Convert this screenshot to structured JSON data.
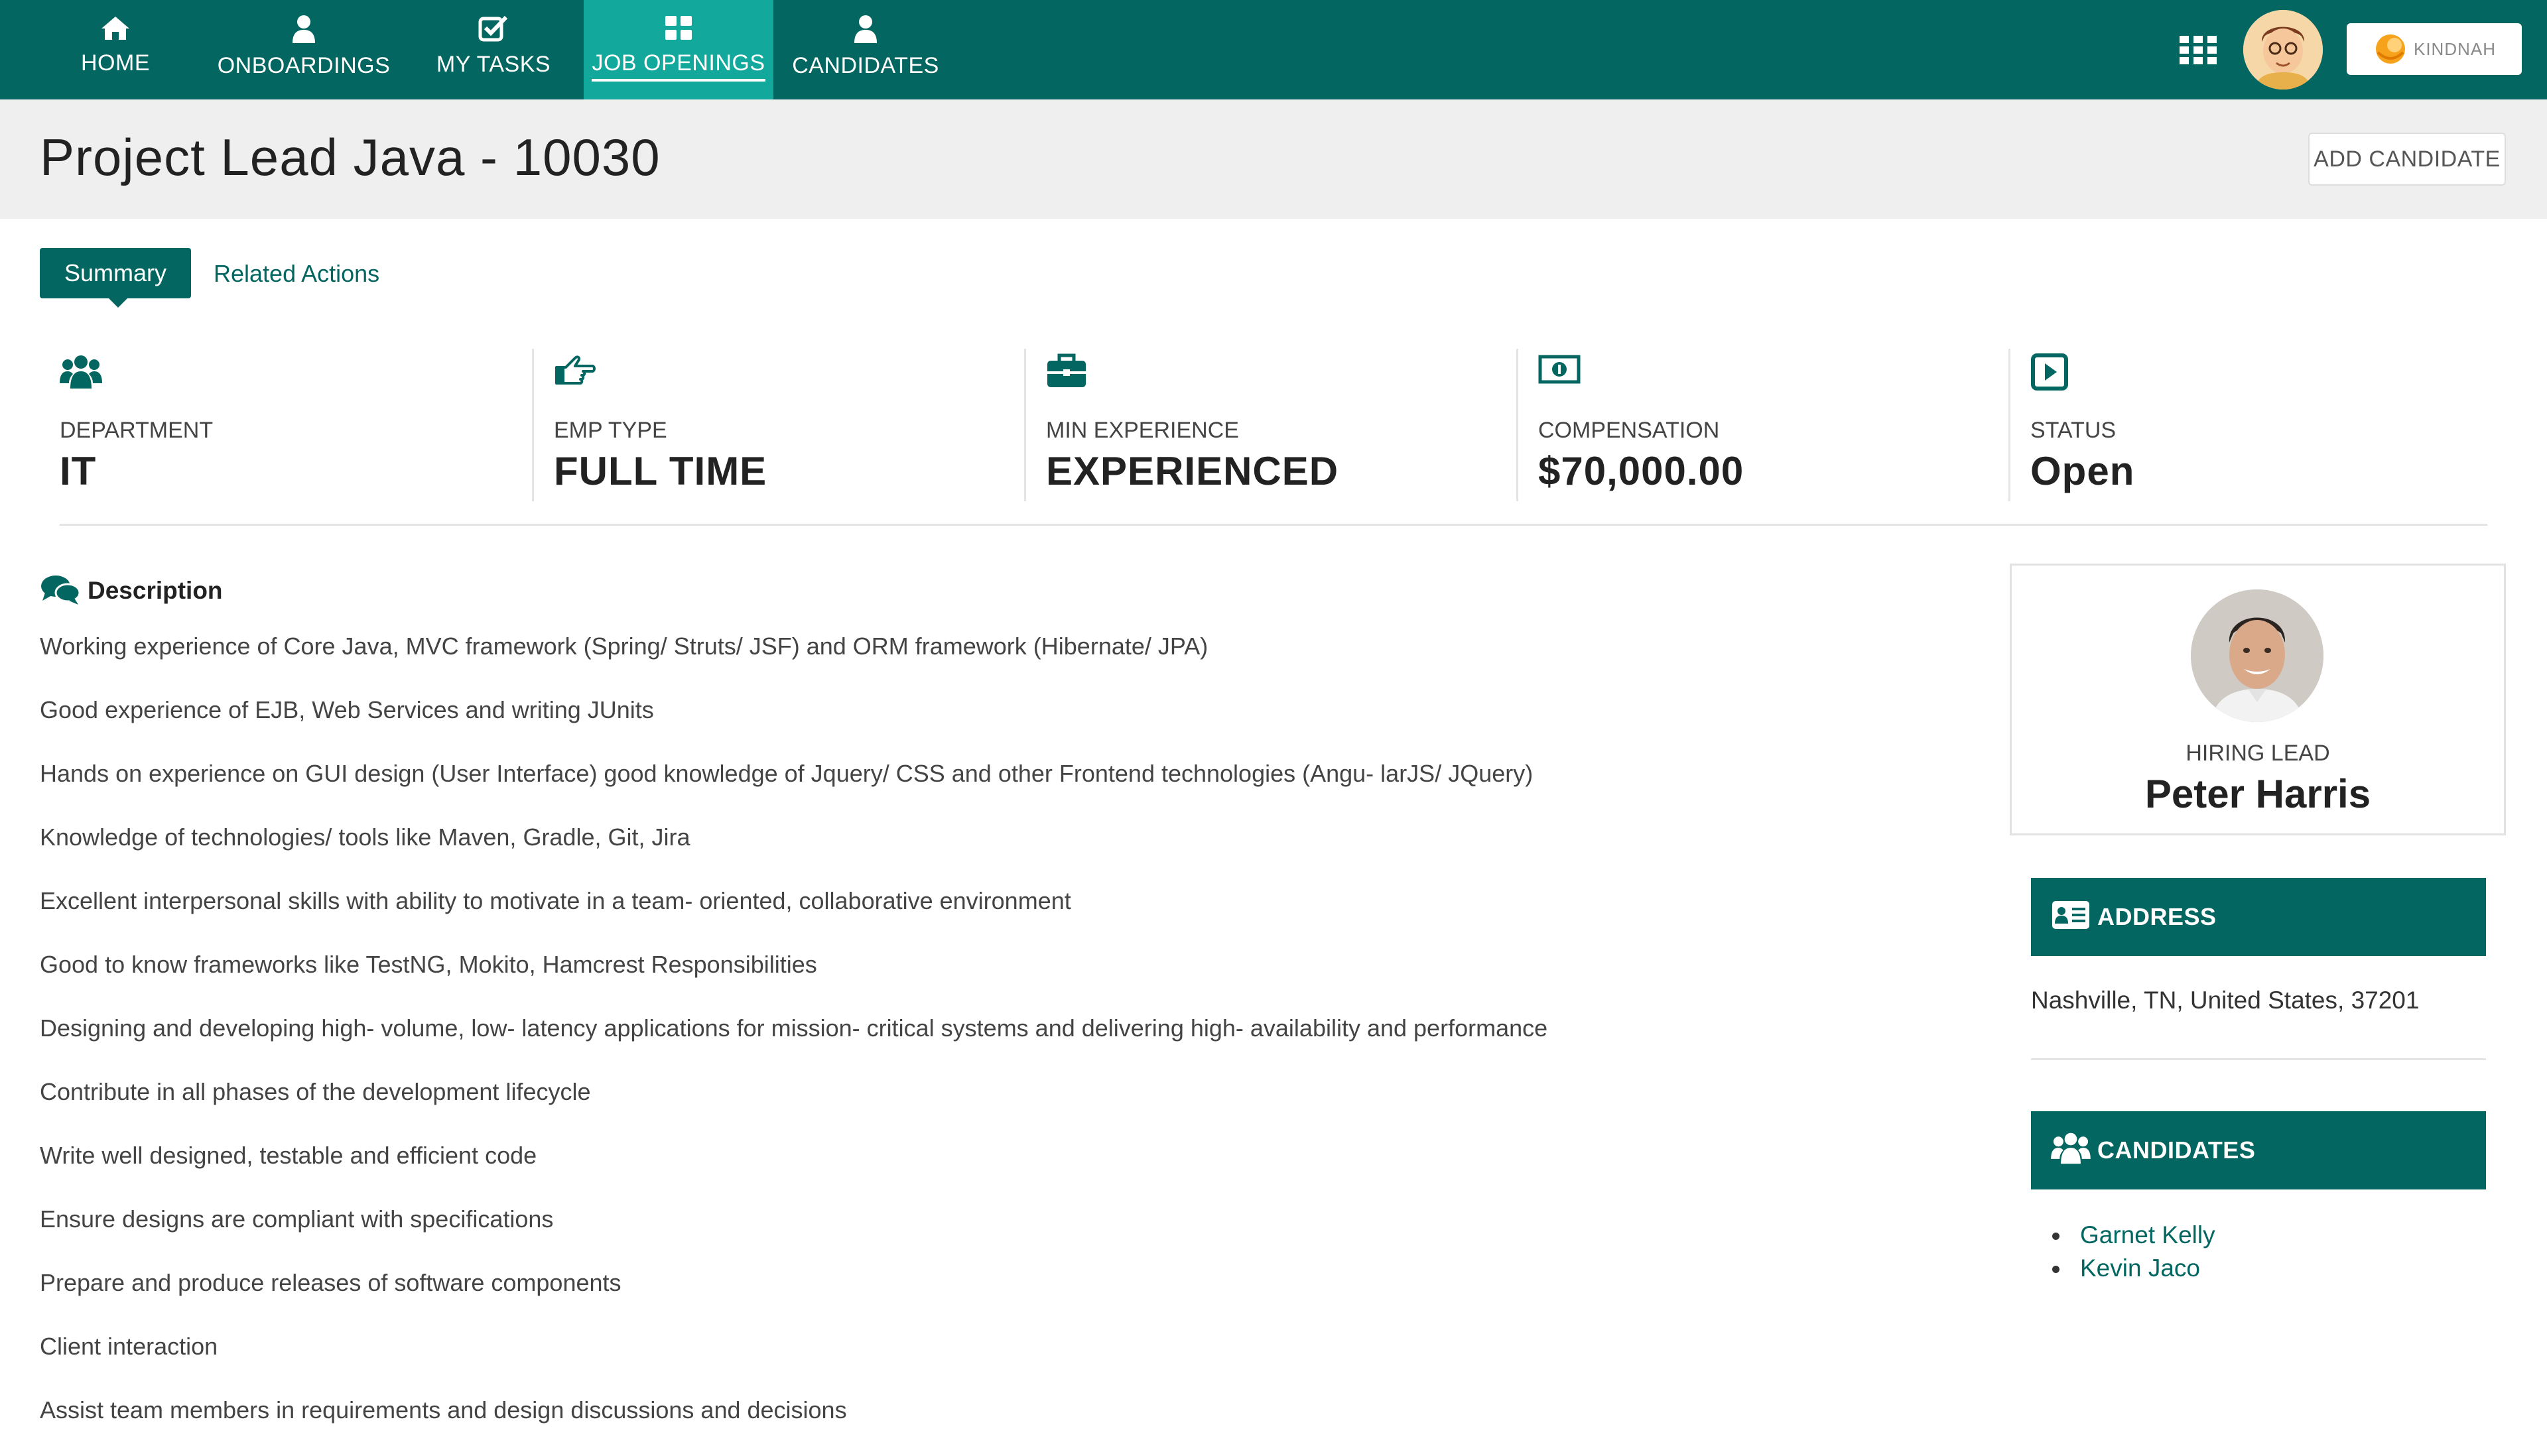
{
  "nav": {
    "items": [
      {
        "label": "HOME",
        "icon": "home-icon"
      },
      {
        "label": "ONBOARDINGS",
        "icon": "user-icon"
      },
      {
        "label": "MY TASKS",
        "icon": "checkbox-icon"
      },
      {
        "label": "JOB OPENINGS",
        "icon": "grid-icon",
        "active": true
      },
      {
        "label": "CANDIDATES",
        "icon": "user-icon"
      }
    ],
    "apps_icon": "apps-grid-icon",
    "logo_text": "KINDNAH"
  },
  "header": {
    "title": "Project Lead Java - 10030",
    "add_candidate_label": "ADD CANDIDATE"
  },
  "tabs": {
    "summary": "Summary",
    "related": "Related Actions"
  },
  "stats": [
    {
      "label": "DEPARTMENT",
      "value": "IT",
      "icon": "users-icon"
    },
    {
      "label": "EMP TYPE",
      "value": "FULL TIME",
      "icon": "hand-pointer-icon"
    },
    {
      "label": "MIN EXPERIENCE",
      "value": "EXPERIENCED",
      "icon": "briefcase-icon"
    },
    {
      "label": "COMPENSATION",
      "value": "$70,000.00",
      "icon": "money-icon"
    },
    {
      "label": "STATUS",
      "value": "Open",
      "icon": "play-square-icon"
    }
  ],
  "description": {
    "title": "Description",
    "lines": [
      "Working experience of Core Java, MVC framework (Spring/ Struts/ JSF) and ORM framework (Hibernate/ JPA)",
      "Good experience of EJB, Web Services and writing JUnits",
      "Hands on experience on GUI design (User Interface) good knowledge of Jquery/ CSS and other Frontend technologies (Angu- larJS/ JQuery)",
      "Knowledge of technologies/ tools like Maven, Gradle, Git, Jira",
      "Excellent interpersonal skills with ability to motivate in a team- oriented, collaborative environment",
      "Good to know frameworks like TestNG, Mokito, Hamcrest Responsibilities",
      "Designing and developing high- volume, low- latency applications for mission- critical systems and delivering high- availability and performance",
      "Contribute in all phases of the development lifecycle",
      "Write well designed, testable and efficient code",
      "Ensure designs are compliant with specifications",
      "Prepare and produce releases of software components",
      "Client interaction",
      "Assist team members in requirements and design discussions and decisions"
    ]
  },
  "hiring_lead": {
    "label": "HIRING LEAD",
    "name": "Peter Harris"
  },
  "address": {
    "title": "ADDRESS",
    "text": "Nashville, TN, United States, 37201"
  },
  "candidates": {
    "title": "CANDIDATES",
    "items": [
      "Garnet Kelly",
      "Kevin Jaco"
    ]
  },
  "colors": {
    "primary": "#036660",
    "active_tab": "#12a89b",
    "title_band": "#efefef"
  }
}
